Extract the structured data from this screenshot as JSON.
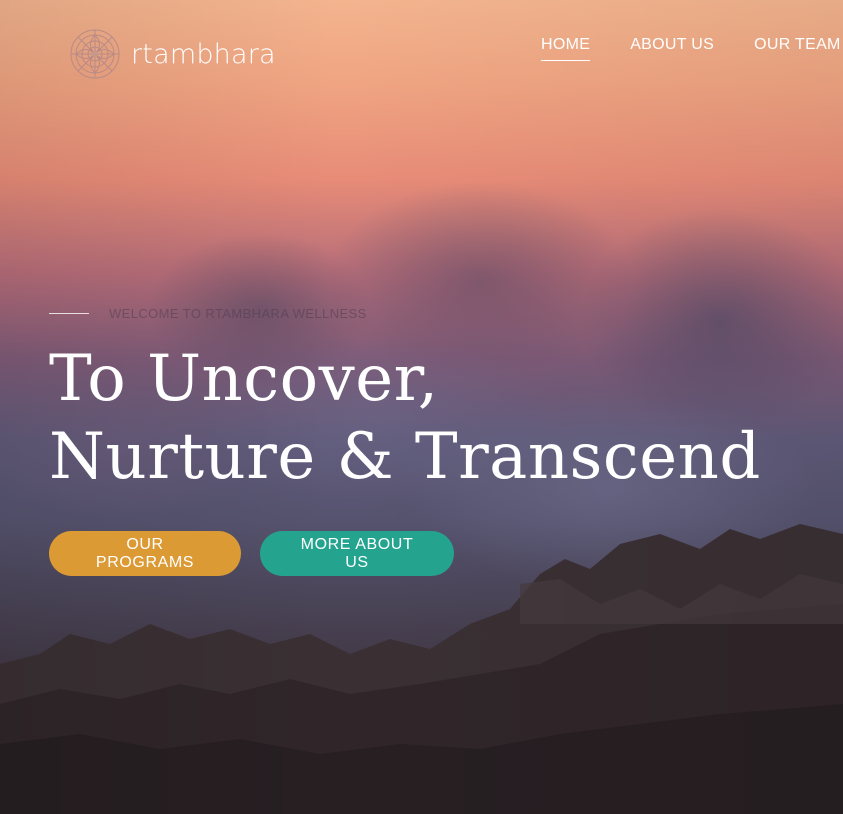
{
  "brand": {
    "name": "rtambhara",
    "logo_icon": "mandala-icon"
  },
  "nav": {
    "items": [
      {
        "label": "HOME",
        "active": true
      },
      {
        "label": "ABOUT US",
        "active": false
      },
      {
        "label": "OUR TEAM",
        "active": false
      }
    ]
  },
  "hero": {
    "eyebrow": "WELCOME TO RTAMBHARA WELLNESS",
    "headline_line1": "To Uncover,",
    "headline_line2": "Nurture & Transcend",
    "buttons": {
      "primary_label": "OUR PROGRAMS",
      "secondary_label": "MORE ABOUT US"
    }
  },
  "colors": {
    "primary_button": "#dc9a35",
    "secondary_button": "#24a48e",
    "text": "#ffffff"
  }
}
